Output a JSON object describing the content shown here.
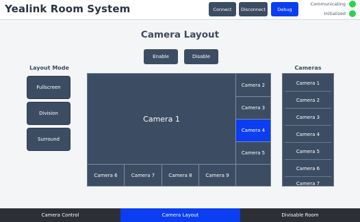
{
  "header": {
    "app_title": "Yealink Room System",
    "connect_label": "Connect",
    "disconnect_label": "Disconnect",
    "debug_label": "Debug",
    "status": {
      "communicating": "Communicating",
      "initialized": "Initialized",
      "dot_color": "#2ed44a"
    }
  },
  "main": {
    "page_title": "Camera Layout",
    "enable_label": "Enable",
    "disable_label": "Disable",
    "layout_mode": {
      "heading": "Layout Mode",
      "modes": [
        "Fullscreen",
        "Division",
        "Surround"
      ]
    },
    "layout": {
      "main_cell": "Camera 1",
      "right_cells": [
        "Camera 2",
        "Camera 3",
        "Camera 4",
        "Camera 5"
      ],
      "bottom_cells": [
        "Camera 6",
        "Camera 7",
        "Camera 8",
        "Camera 9"
      ],
      "selected": "Camera 4"
    },
    "cameras": {
      "heading": "Cameras",
      "items": [
        "Camera 1",
        "Camera 2",
        "Camera 3",
        "Camera 4",
        "Camera 5",
        "Camera 6",
        "Camera 7"
      ]
    }
  },
  "footer": {
    "tabs": [
      "Camera Control",
      "Camera Layout",
      "Divisable Room"
    ],
    "active_tab": "Camera Layout"
  },
  "colors": {
    "accent": "#0b3ef0",
    "panel": "#3c4d63",
    "footer": "#2c2f36"
  }
}
